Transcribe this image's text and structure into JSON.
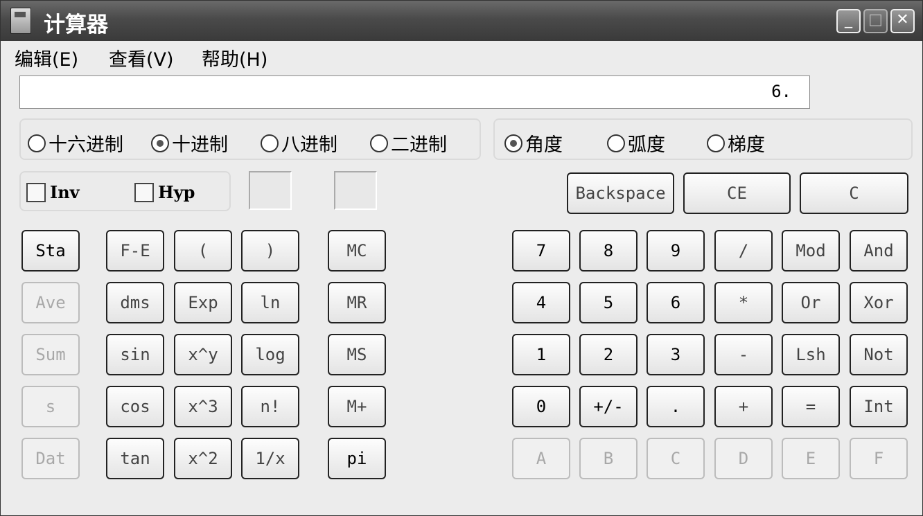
{
  "window": {
    "title": "计算器",
    "minimize_glyph": "_",
    "maximize_glyph": "□",
    "close_glyph": "✕"
  },
  "menu": [
    "编辑(E)",
    "查看(V)",
    "帮助(H)"
  ],
  "display": {
    "value": "6."
  },
  "number_system": {
    "options": [
      {
        "label": "十六进制",
        "selected": false
      },
      {
        "label": "十进制",
        "selected": true
      },
      {
        "label": "八进制",
        "selected": false
      },
      {
        "label": "二进制",
        "selected": false
      }
    ]
  },
  "angle_unit": {
    "options": [
      {
        "label": "角度",
        "selected": true
      },
      {
        "label": "弧度",
        "selected": false
      },
      {
        "label": "梯度",
        "selected": false
      }
    ]
  },
  "checkboxes": [
    {
      "label": "Inv",
      "checked": false
    },
    {
      "label": "Hyp",
      "checked": false
    }
  ],
  "top_buttons": [
    "Backspace",
    "CE",
    "C"
  ],
  "stat_buttons": [
    {
      "label": "Sta",
      "enabled": true
    },
    {
      "label": "Ave",
      "enabled": false
    },
    {
      "label": "Sum",
      "enabled": false
    },
    {
      "label": "s",
      "enabled": false
    },
    {
      "label": "Dat",
      "enabled": false
    }
  ],
  "function_buttons": [
    [
      "F-E",
      "(",
      ")"
    ],
    [
      "dms",
      "Exp",
      "ln"
    ],
    [
      "sin",
      "x^y",
      "log"
    ],
    [
      "cos",
      "x^3",
      "n!"
    ],
    [
      "tan",
      "x^2",
      "1/x"
    ]
  ],
  "memory_buttons": [
    "MC",
    "MR",
    "MS",
    "M+",
    "pi"
  ],
  "keypad": [
    [
      {
        "label": "7"
      },
      {
        "label": "8"
      },
      {
        "label": "9"
      },
      {
        "label": "/"
      },
      {
        "label": "Mod"
      },
      {
        "label": "And"
      }
    ],
    [
      {
        "label": "4"
      },
      {
        "label": "5"
      },
      {
        "label": "6"
      },
      {
        "label": "*"
      },
      {
        "label": "Or"
      },
      {
        "label": "Xor"
      }
    ],
    [
      {
        "label": "1"
      },
      {
        "label": "2"
      },
      {
        "label": "3"
      },
      {
        "label": "-"
      },
      {
        "label": "Lsh"
      },
      {
        "label": "Not"
      }
    ],
    [
      {
        "label": "0"
      },
      {
        "label": "+/-"
      },
      {
        "label": "."
      },
      {
        "label": "+"
      },
      {
        "label": "="
      },
      {
        "label": "Int"
      }
    ],
    [
      {
        "label": "A",
        "enabled": false
      },
      {
        "label": "B",
        "enabled": false
      },
      {
        "label": "C",
        "enabled": false
      },
      {
        "label": "D",
        "enabled": false
      },
      {
        "label": "E",
        "enabled": false
      },
      {
        "label": "F",
        "enabled": false
      }
    ]
  ]
}
